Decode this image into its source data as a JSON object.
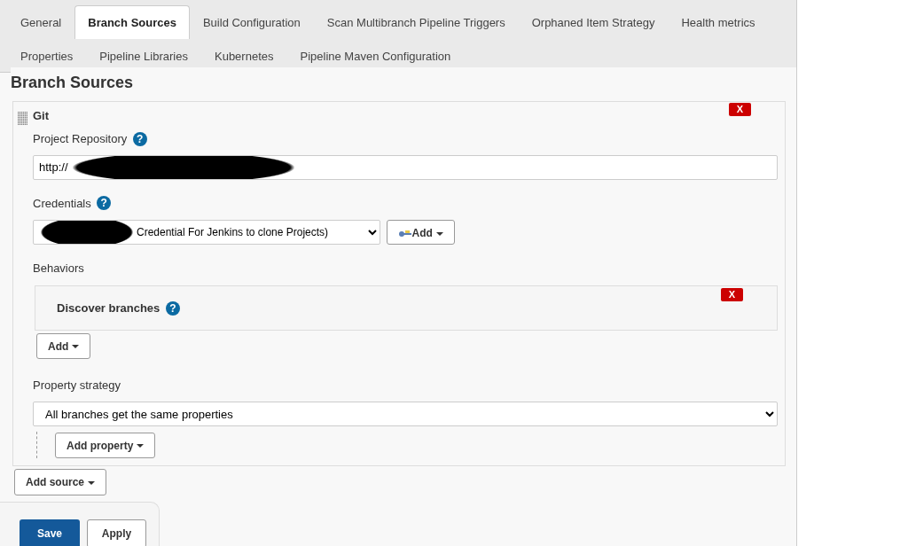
{
  "tabs": [
    {
      "label": "General",
      "selected": false
    },
    {
      "label": "Branch Sources",
      "selected": true
    },
    {
      "label": "Build Configuration",
      "selected": false
    },
    {
      "label": "Scan Multibranch Pipeline Triggers",
      "selected": false
    },
    {
      "label": "Orphaned Item Strategy",
      "selected": false
    },
    {
      "label": "Health metrics",
      "selected": false
    },
    {
      "label": "Properties",
      "selected": false
    },
    {
      "label": "Pipeline Libraries",
      "selected": false
    },
    {
      "label": "Kubernetes",
      "selected": false
    },
    {
      "label": "Pipeline Maven Configuration",
      "selected": false
    }
  ],
  "section_title": "Branch Sources",
  "source": {
    "title": "Git",
    "delete_label": "X",
    "repository": {
      "label": "Project Repository",
      "help": "?",
      "value": "http://",
      "redacted": true
    },
    "credentials": {
      "label": "Credentials",
      "help": "?",
      "value": "Credential For Jenkins to clone Projects)",
      "redacted": true,
      "add_label": "Add"
    },
    "behaviors": {
      "label": "Behaviors",
      "items": [
        {
          "title": "Discover branches",
          "help": "?",
          "delete_label": "X"
        }
      ],
      "add_label": "Add"
    },
    "property_strategy": {
      "label": "Property strategy",
      "value": "All branches get the same properties",
      "add_label": "Add property"
    }
  },
  "add_source_label": "Add source",
  "buttons": [
    {
      "label": "Save",
      "primary": true
    },
    {
      "label": "Apply",
      "primary": false
    }
  ]
}
